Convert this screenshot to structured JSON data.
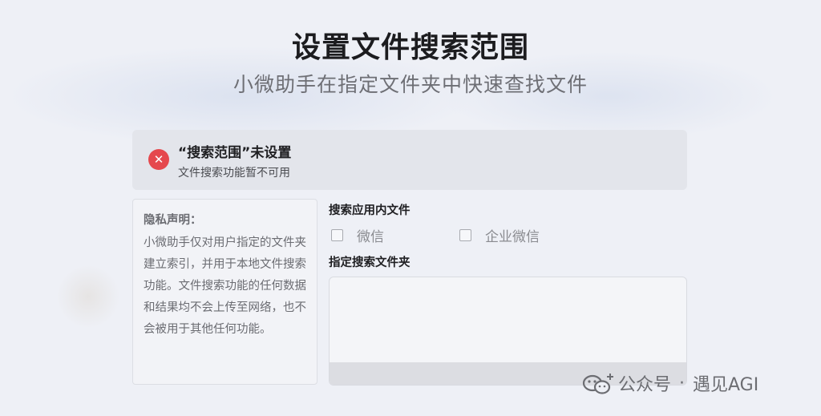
{
  "header": {
    "title": "设置文件搜索范围",
    "subtitle": "小微助手在指定文件夹中快速查找文件"
  },
  "alert": {
    "icon": "close-icon",
    "icon_glyph": "✕",
    "title": "“搜索范围”未设置",
    "description": "文件搜索功能暂不可用",
    "color": "#e5484d"
  },
  "privacy": {
    "heading": "隐私声明：",
    "body": "小微助手仅对用户指定的文件夹建立索引，并用于本地文件搜索功能。文件搜索功能的任何数据和结果均不会上传至网络，也不会被用于其他任何功能。"
  },
  "apps_section": {
    "label": "搜索应用内文件",
    "options": [
      {
        "label": "微信",
        "checked": false
      },
      {
        "label": "企业微信",
        "checked": false
      }
    ]
  },
  "folder_section": {
    "label": "指定搜索文件夹"
  },
  "watermark": {
    "source": "公众号",
    "separator": "·",
    "account": "遇见AGI"
  }
}
